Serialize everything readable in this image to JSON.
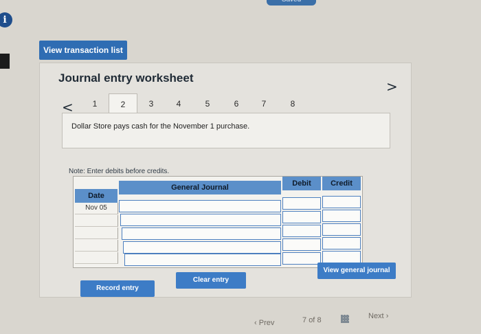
{
  "header": {
    "saved_label": "Saved",
    "view_transaction_list": "View transaction list"
  },
  "worksheet": {
    "title": "Journal entry worksheet",
    "prev_symbol": "<",
    "next_symbol": ">",
    "tabs": [
      "1",
      "2",
      "3",
      "4",
      "5",
      "6",
      "7",
      "8"
    ],
    "active_tab": "2",
    "instruction": "Dollar Store pays cash for the November 1 purchase."
  },
  "journal": {
    "note": "Note: Enter debits before credits.",
    "columns": {
      "date": "Date",
      "general_journal": "General Journal",
      "debit": "Debit",
      "credit": "Credit"
    },
    "rows": [
      {
        "date": "Nov 05",
        "account": "",
        "debit": "",
        "credit": ""
      },
      {
        "date": "",
        "account": "",
        "debit": "",
        "credit": ""
      },
      {
        "date": "",
        "account": "",
        "debit": "",
        "credit": ""
      },
      {
        "date": "",
        "account": "",
        "debit": "",
        "credit": ""
      },
      {
        "date": "",
        "account": "",
        "debit": "",
        "credit": ""
      },
      {
        "date": "",
        "account": "",
        "debit": "",
        "credit": ""
      }
    ]
  },
  "actions": {
    "record_entry": "Record entry",
    "clear_entry": "Clear entry",
    "view_general_journal": "View general journal"
  },
  "pagination": {
    "prev": "Prev",
    "current": "7",
    "of_label": "of",
    "total": "8",
    "next": "Next"
  },
  "colors": {
    "accent": "#2f6db3",
    "header_blue": "#5b8fc9"
  }
}
